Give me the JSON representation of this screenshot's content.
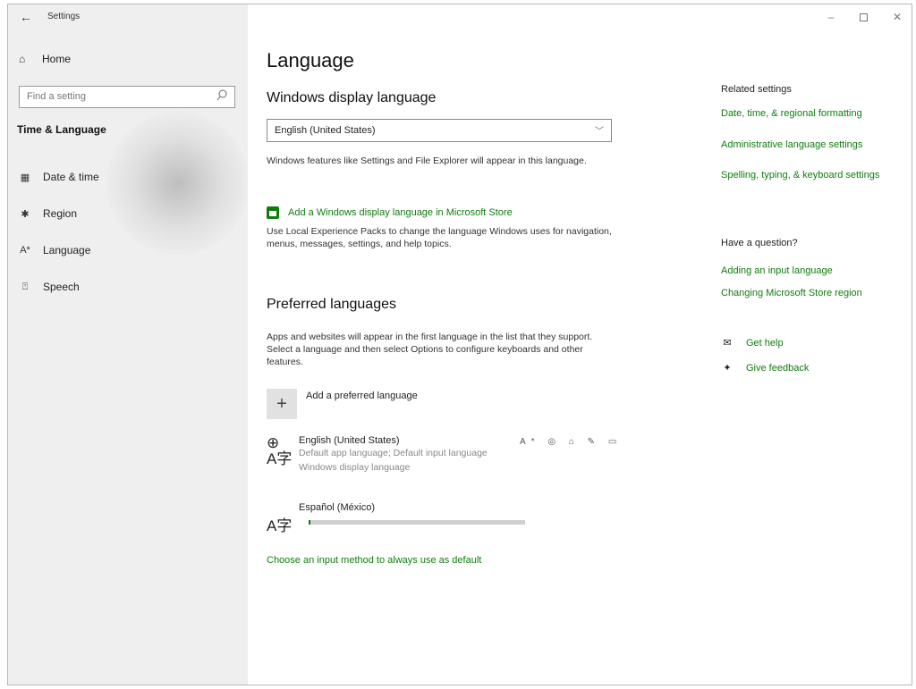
{
  "window": {
    "title": "Settings",
    "back_icon": "back-arrow-icon",
    "minimize_glyph": "–",
    "close_glyph": "✕"
  },
  "sidebar": {
    "home_label": "Home",
    "search_placeholder": "Find a setting",
    "section_title": "Time & Language",
    "items": [
      {
        "label": "Date & time",
        "icon": "calendar-clock-icon"
      },
      {
        "label": "Region",
        "icon": "globe-region-icon"
      },
      {
        "label": "Language",
        "icon": "language-icon"
      },
      {
        "label": "Speech",
        "icon": "microphone-icon"
      }
    ]
  },
  "main": {
    "page_title": "Language",
    "display_language_heading": "Windows display language",
    "display_language_value": "English (United States)",
    "display_language_desc": "Windows features like Settings and File Explorer will appear in this language.",
    "store_link": "Add a Windows display language in Microsoft Store",
    "experience_pack_desc": "Use Local Experience Packs to change the language Windows uses for navigation, menus, messages, settings, and help topics.",
    "preferred_heading": "Preferred languages",
    "preferred_desc": "Apps and websites will appear in the first language in the list that they support. Select a language and then select Options to configure keyboards and other features.",
    "add_preferred": "Add a preferred language",
    "languages": [
      {
        "name": "English (United States)",
        "line1": "Default app language; Default input language",
        "line2": "Windows display language",
        "feature_icons": "A* ◎ ⌂ ✎ ▭"
      },
      {
        "name": "Español (México)",
        "progress": 0.01
      }
    ],
    "input_method_link": "Choose an input method to always use as default"
  },
  "right": {
    "related_heading": "Related settings",
    "related_links": [
      "Date, time, & regional formatting",
      "Administrative language settings",
      "Spelling, typing, & keyboard settings"
    ],
    "question_heading": "Have a question?",
    "question_links": [
      "Adding an input language",
      "Changing Microsoft Store region"
    ],
    "get_help": "Get help",
    "give_feedback": "Give feedback"
  },
  "colors": {
    "accent": "#107c10",
    "sidebar_bg": "#efefef"
  }
}
